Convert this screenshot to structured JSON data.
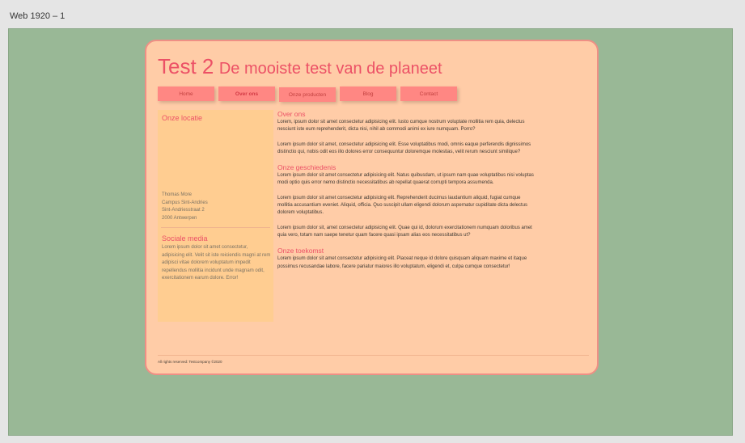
{
  "frame": {
    "label": "Web 1920 – 1"
  },
  "header": {
    "title": "Test 2",
    "subtitle": "De mooiste test van de planeet"
  },
  "nav": {
    "items": [
      "Home",
      "Over ons",
      "Onze producten",
      "Blog",
      "Contact"
    ],
    "active": "Over ons"
  },
  "sidebar": {
    "location_heading": "Onze locatie",
    "address": [
      "Thomas More",
      "Campus Sint-Andries",
      "Sint-Andriesstraat 2",
      "2000 Antwerpen"
    ],
    "social_heading": "Sociale media",
    "social_text": "Lorem ipsum dolor sit amet consectetur, adipisicing elit. Velit sit iste reiciendis magni at rem adipisci vitae dolorem voluptatum impedit repellendus mollitia incidunt unde magnam odit, exercitationem earum dolore. Error!"
  },
  "main": {
    "sections": [
      {
        "title": "Over ons",
        "paragraphs": [
          "Lorem, ipsum dolor sit amet consectetur adipisicing elit. Iusto cumque nostrum voluptate mollitia rem quia, delectus nesciunt iste eum reprehenderit, dicta nisi, nihil ab commodi animi ex iure numquam. Porro?",
          "Lorem ipsum dolor sit amet, consectetur adipisicing elit. Esse voluptatibus modi, omnis eaque perferendis dignissimos distinctio qui, nobis odit eos illo dolores error consequuntur doloremque molestias, velit rerum nesciunt similique?"
        ]
      },
      {
        "title": "Onze geschiedenis",
        "paragraphs": [
          "Lorem ipsum dolor sit amet consectetur adipisicing elit. Natus quibusdam, ut ipsum nam quae voluptatibus nisi voluptas modi optio quis error nemo distinctio necessitatibus ab repellat quaerat corrupti tempora assumenda.",
          "Lorem ipsum dolor sit amet consectetur adipisicing elit. Reprehenderit ducimus laudantium aliquid, fugiat cumque mollitia accusantium eveniet. Aliquid, officia. Quo suscipit ullam eligendi dolorum aspernatur cupiditate dicta delectus dolorem voluptatibus.",
          "Lorem ipsum dolor sit, amet consectetur adipisicing elit. Quae qui id, dolorum exercitationem numquam doloribus amet quia vero, totam nam saepe tenetur quam facere quasi ipsam alias eos necessitatibus ut?"
        ]
      },
      {
        "title": "Onze toekomst",
        "paragraphs": [
          "Lorem ipsum dolor sit amet consectetur adipisicing elit. Placeat neque id dolore quisquam aliquam maxime et itaque possimus recusandae labore, facere pariatur maiores illo voluptatum, eligendi et, culpa cumque consectetur!"
        ]
      }
    ]
  },
  "footer": {
    "text": "All rights reserved: Testcompany ©2020"
  },
  "colors": {
    "canvas": "#e5e5e5",
    "artboard": "#99b896",
    "card": "#ffcca7",
    "card_border": "#ef8f85",
    "accent": "#ec5166",
    "nav_button": "#ff8783",
    "sidebar": "#ffcd91"
  }
}
